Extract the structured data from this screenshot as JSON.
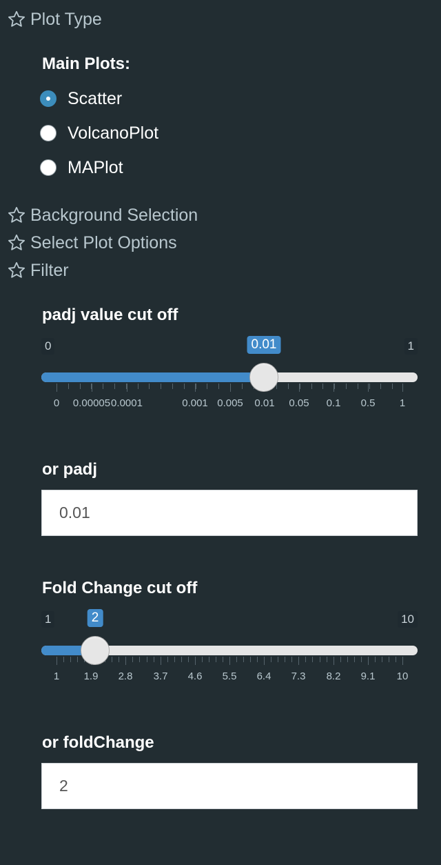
{
  "sections": {
    "plot_type": "Plot Type",
    "background_selection": "Background Selection",
    "select_plot_options": "Select Plot Options",
    "filter": "Filter"
  },
  "main_plots": {
    "label": "Main Plots:",
    "options": [
      "Scatter",
      "VolcanoPlot",
      "MAPlot"
    ],
    "selected": "Scatter"
  },
  "padj_slider": {
    "label": "padj value cut off",
    "min_label": "0",
    "max_label": "1",
    "value_label": "0.01",
    "tick_labels": [
      "0",
      "0.00005",
      "0.0001",
      "0.001",
      "0.005",
      "0.01",
      "0.05",
      "0.1",
      "0.5",
      "1"
    ]
  },
  "or_padj": {
    "label": "or padj",
    "value": "0.01"
  },
  "fc_slider": {
    "label": "Fold Change cut off",
    "min_label": "1",
    "max_label": "10",
    "value_label": "2",
    "tick_labels": [
      "1",
      "1.9",
      "2.8",
      "3.7",
      "4.6",
      "5.5",
      "6.4",
      "7.3",
      "8.2",
      "9.1",
      "10"
    ]
  },
  "or_fold_change": {
    "label": "or foldChange",
    "value": "2"
  },
  "colors": {
    "sidebar_bg": "#222d32",
    "accent": "#428bca",
    "text_muted": "#b8c7ce",
    "text_strong": "#ffffff"
  }
}
